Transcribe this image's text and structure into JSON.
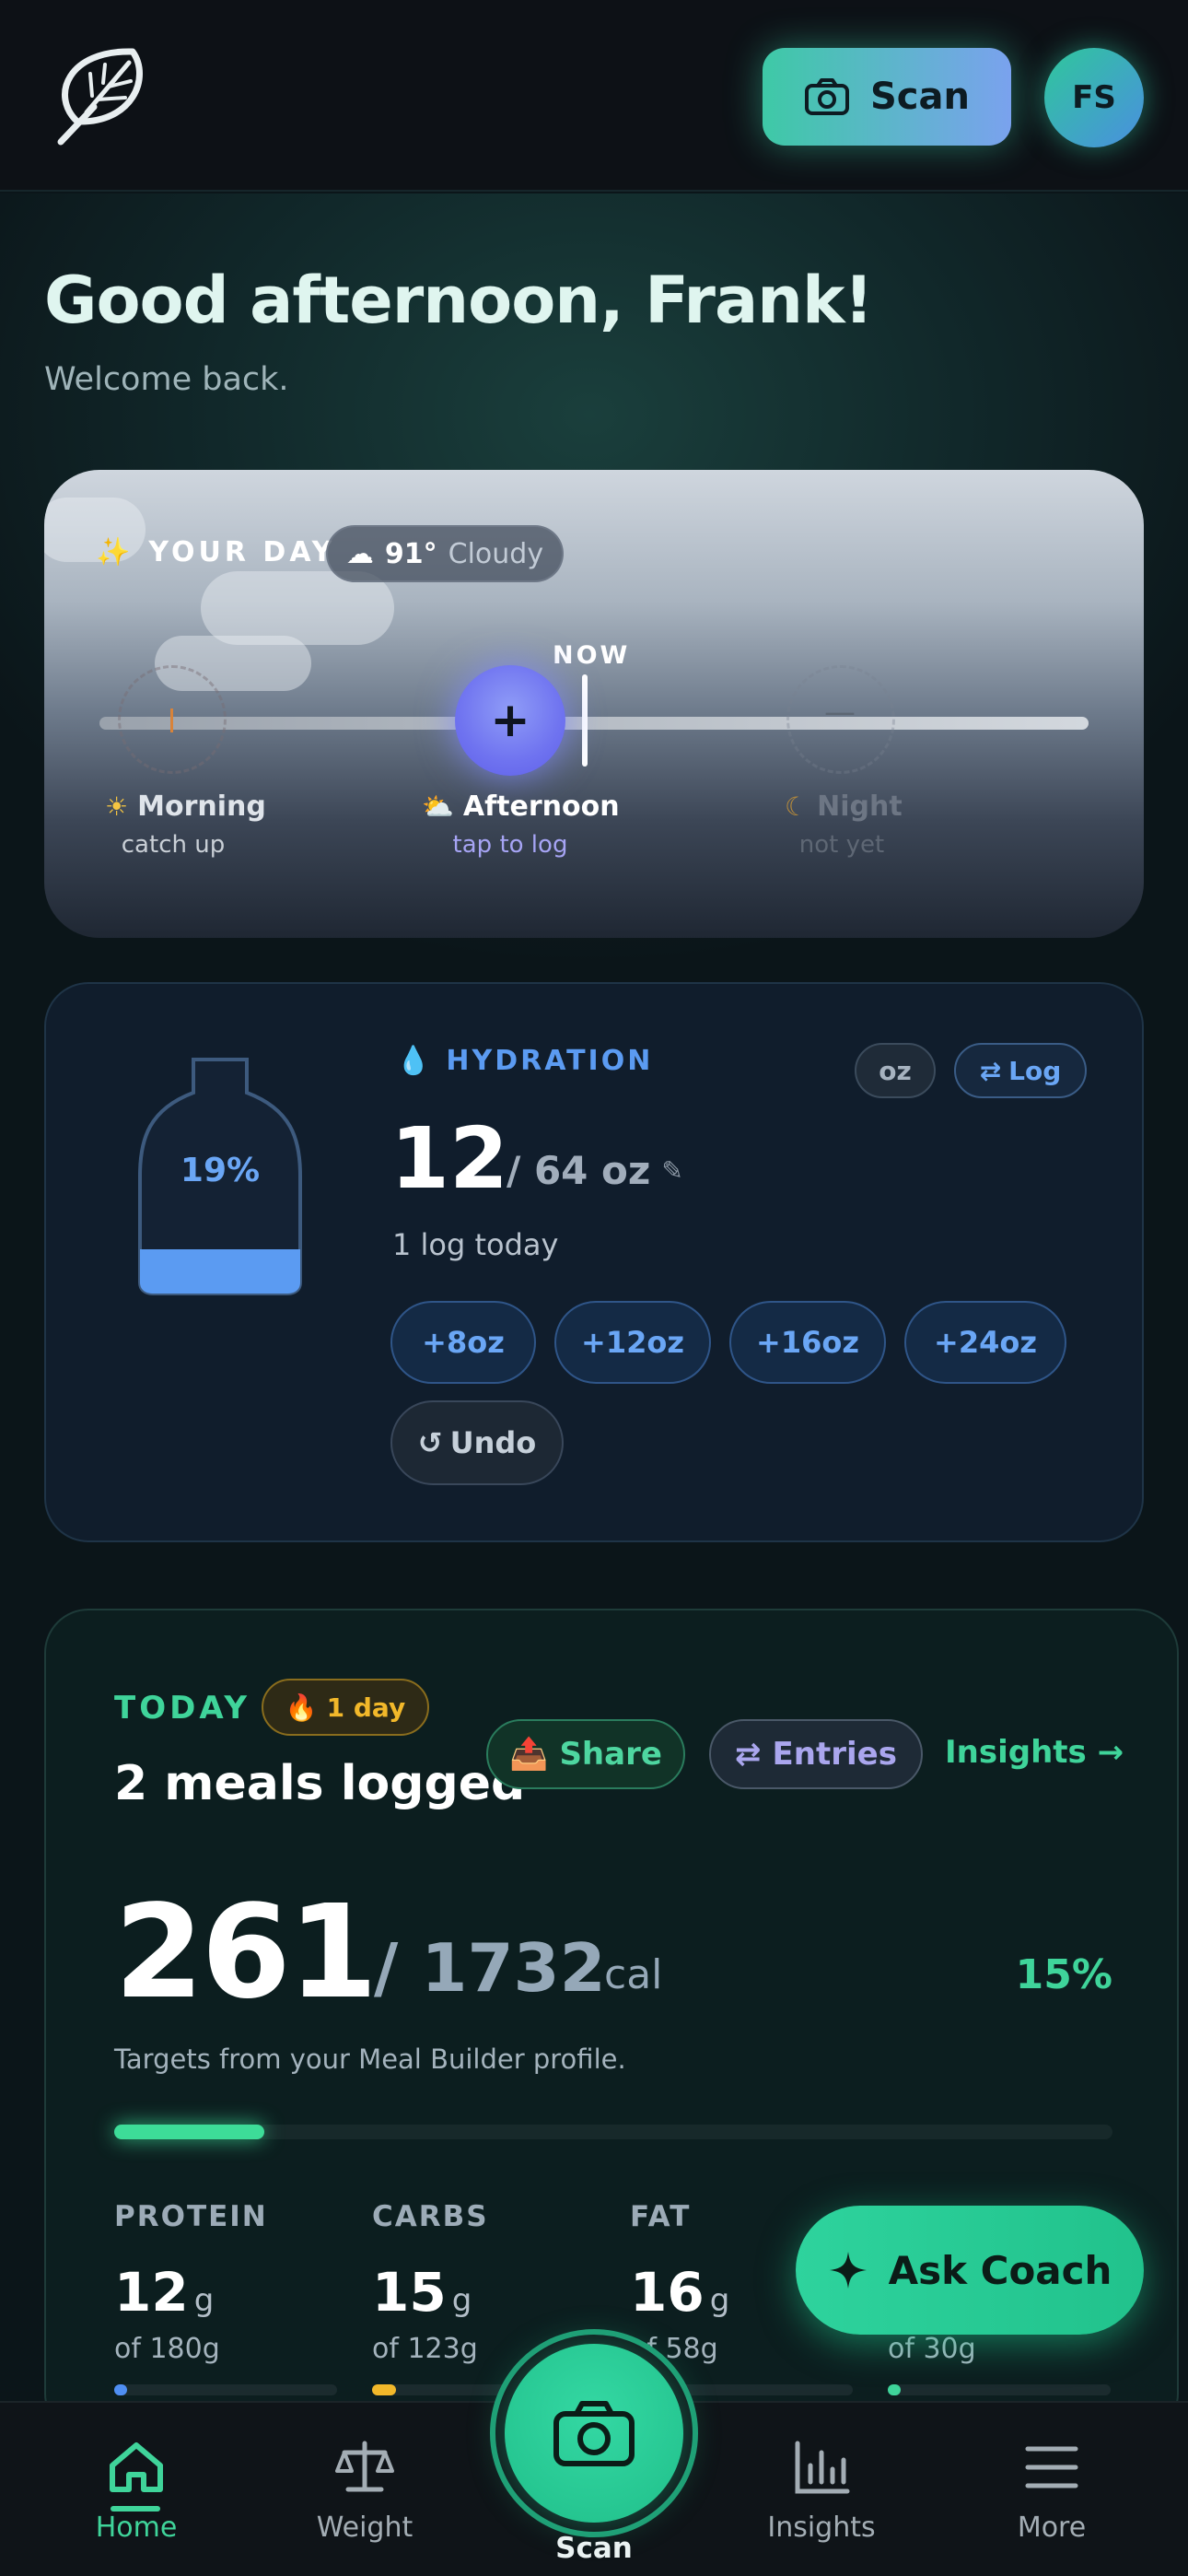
{
  "header": {
    "scan_label": "Scan",
    "avatar_initials": "FS"
  },
  "greeting": {
    "title": "Good afternoon, Frank!",
    "subtitle": "Welcome back."
  },
  "day": {
    "label": "YOUR DAY",
    "weather_temp": "91°",
    "weather_desc": "Cloudy",
    "now_label": "NOW",
    "slots": [
      {
        "name": "Morning",
        "sub": "catch up",
        "icon": "sun-icon"
      },
      {
        "name": "Afternoon",
        "sub": "tap to log",
        "icon": "sun-cloud-icon"
      },
      {
        "name": "Night",
        "sub": "not yet",
        "icon": "moon-icon"
      }
    ],
    "add_symbol": "+",
    "night_symbol": "—"
  },
  "hydration": {
    "label": "HYDRATION",
    "percent": "19%",
    "fill_fraction": 0.19,
    "amount": "12",
    "goal": "/ 64 oz",
    "log_count": "1 log today",
    "unit": "oz",
    "log_label": "Log",
    "quick_adds": [
      "+8oz",
      "+12oz",
      "+16oz",
      "+24oz"
    ],
    "undo_label": "Undo"
  },
  "today": {
    "label": "TODAY",
    "streak": "1 day",
    "meals": "2 meals logged",
    "share_label": "Share",
    "entries_label": "Entries",
    "insights_label": "Insights →",
    "calories": "261",
    "goal": "/ 1732",
    "unit": "cal",
    "percent": "15%",
    "percent_value": 0.15,
    "targets_note": "Targets from your Meal Builder profile.",
    "macros": [
      {
        "name": "PROTEIN",
        "value": "12",
        "unit": "g",
        "of": "of 180g",
        "color": "#4f8ef2"
      },
      {
        "name": "CARBS",
        "value": "15",
        "unit": "g",
        "of": "of 123g",
        "color": "#f2b82a"
      },
      {
        "name": "FAT",
        "value": "16",
        "unit": "g",
        "of": "of 58g",
        "color": "#e46a6a"
      },
      {
        "name": "",
        "value": "",
        "unit": "",
        "of": "of 30g",
        "color": "#3fd49a"
      }
    ]
  },
  "coach": {
    "label": "Ask Coach"
  },
  "nav": {
    "items": [
      {
        "label": "Home",
        "icon": "home-icon"
      },
      {
        "label": "Weight",
        "icon": "scale-icon"
      },
      {
        "label": "Scan",
        "icon": "camera-icon"
      },
      {
        "label": "Insights",
        "icon": "bar-chart-icon"
      },
      {
        "label": "More",
        "icon": "menu-icon"
      }
    ]
  },
  "colors": {
    "accent": "#3fd49a",
    "blue": "#6aa6f5",
    "purple": "#aaa6ee"
  }
}
